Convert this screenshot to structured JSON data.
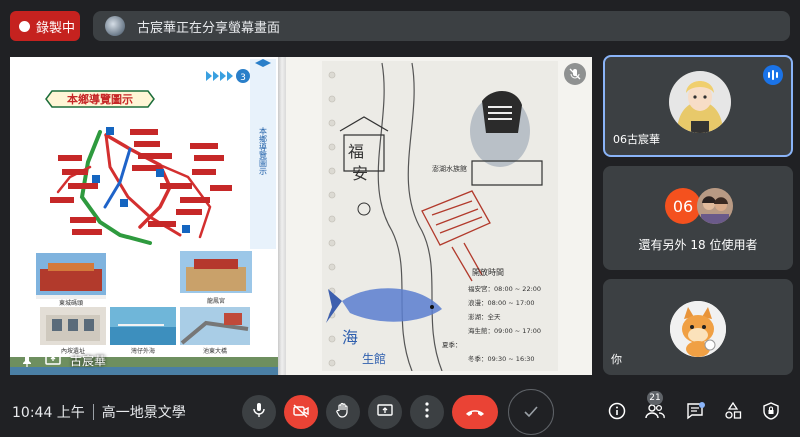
{
  "recording": {
    "label": "錄製中"
  },
  "share_banner": {
    "text": "古宸華正在分享螢幕畫面"
  },
  "stage": {
    "presenter_name": "古宸華",
    "brochure": {
      "title": "本鄉導覽圖示",
      "side_title": "本鄉導覽圖示",
      "page_badge": "3",
      "caption_1": "東城碼頭",
      "caption_2": "龍鳳宮",
      "caption_3": "內垵遺址",
      "caption_4": "灣仔外海",
      "caption_5": "池東大橋"
    },
    "sketch": {
      "label_fu": "福",
      "label_an": "安",
      "label_park": "澎湖水族館",
      "label_hours_title": "開放時間",
      "hours": [
        "福安宮：08:00 ~ 22:00",
        "浪漫：08:00 ~ 17:00",
        "澎湖：全天",
        "海生館：09:00 ~ 17:00",
        "夏季：",
        "冬季：09:30 ~ 16:30"
      ],
      "label_sea": "海",
      "label_life": "生館"
    }
  },
  "participants": {
    "main": {
      "name": "06古宸華"
    },
    "others": {
      "count": "06",
      "label": "還有另外 18 位使用者"
    },
    "self": {
      "name": "你"
    }
  },
  "bottom_bar": {
    "time": "10:44 上午",
    "meeting_name": "高一地景文學",
    "people_count": "21"
  },
  "colors": {
    "background": "#202124",
    "tile": "#3c4043",
    "recording": "#c5221f",
    "danger": "#ea4335",
    "active_border": "#8ab4f8",
    "badge_orange": "#f4511e"
  }
}
